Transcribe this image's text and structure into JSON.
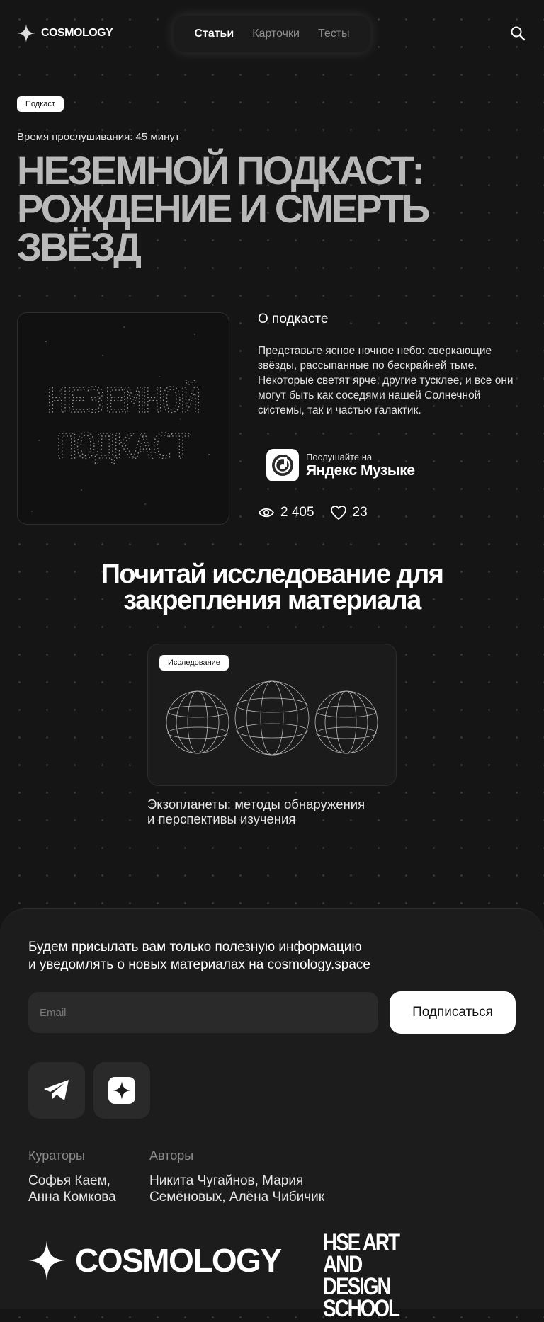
{
  "header": {
    "logo": "COSMOLOGY",
    "nav": [
      "Статьи",
      "Карточки",
      "Тесты"
    ],
    "active_nav": "Статьи"
  },
  "hero": {
    "tag": "Подкаст",
    "listen_time": "Время прослушивания: 45 минут",
    "title_lines": [
      "Неземной подкаст:",
      "рождение и смерть",
      "звёзд"
    ]
  },
  "cover": {
    "lines": [
      "НЕЗЕМНОЙ",
      "ПОДКАСТ"
    ]
  },
  "about": {
    "heading": "О подкасте",
    "text": "Представьте ясное ночное небо: сверкающие звёзды, рассыпанные по бескрайней тьме. Некоторые светят ярче, другие тусклее, и все они могут быть как соседями нашей Солнечной системы, так и частью галактик."
  },
  "yandex": {
    "small": "Послушайте на",
    "big": "Яндекс Музыке"
  },
  "stats": {
    "views": "2 405",
    "likes": "23"
  },
  "research": {
    "heading_lines": [
      "Почитай исследование для",
      "закрепления материала"
    ],
    "tag": "Исследование",
    "title_lines": [
      "Экзопланеты: методы обнаружения",
      "и перспективы изучения"
    ]
  },
  "footer": {
    "text_lines": [
      "Будем присылать вам только полезную информацию",
      "и уведомлять о новых материалах на cosmology.space"
    ],
    "email_placeholder": "Email",
    "subscribe": "Подписаться",
    "curators_label": "Кураторы",
    "curators": "Софья Каем, Анна Комкова",
    "authors_label": "Авторы",
    "authors": "Никита Чугайнов, Мария Семёновых, Алёна Чибичик",
    "logo": "COSMOLOGY",
    "school_lines": [
      "HSE ART AND",
      "DESIGN SCHOOL"
    ]
  },
  "colors": {
    "background": "#151515",
    "footer": "#1c1c1c",
    "title_gray": "#b9b9b9",
    "accent": "#ffffff"
  }
}
